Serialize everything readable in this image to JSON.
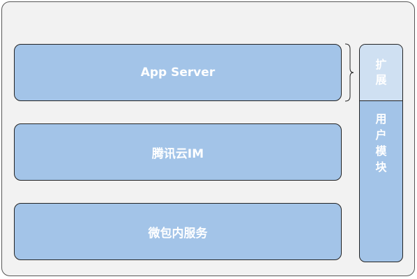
{
  "layers": [
    {
      "label": "App Server"
    },
    {
      "label": "腾讯云IM"
    },
    {
      "label": "微包内服务"
    }
  ],
  "side": {
    "top_chars": [
      "扩",
      "展"
    ],
    "bottom_chars": [
      "用",
      "户",
      "模",
      "块"
    ]
  },
  "colors": {
    "outer_bg": "#f2f2f2",
    "layer_fill": "#a3c4e8",
    "side_top_fill": "#cfe0f2",
    "border": "#222222",
    "text": "#ffffff"
  }
}
